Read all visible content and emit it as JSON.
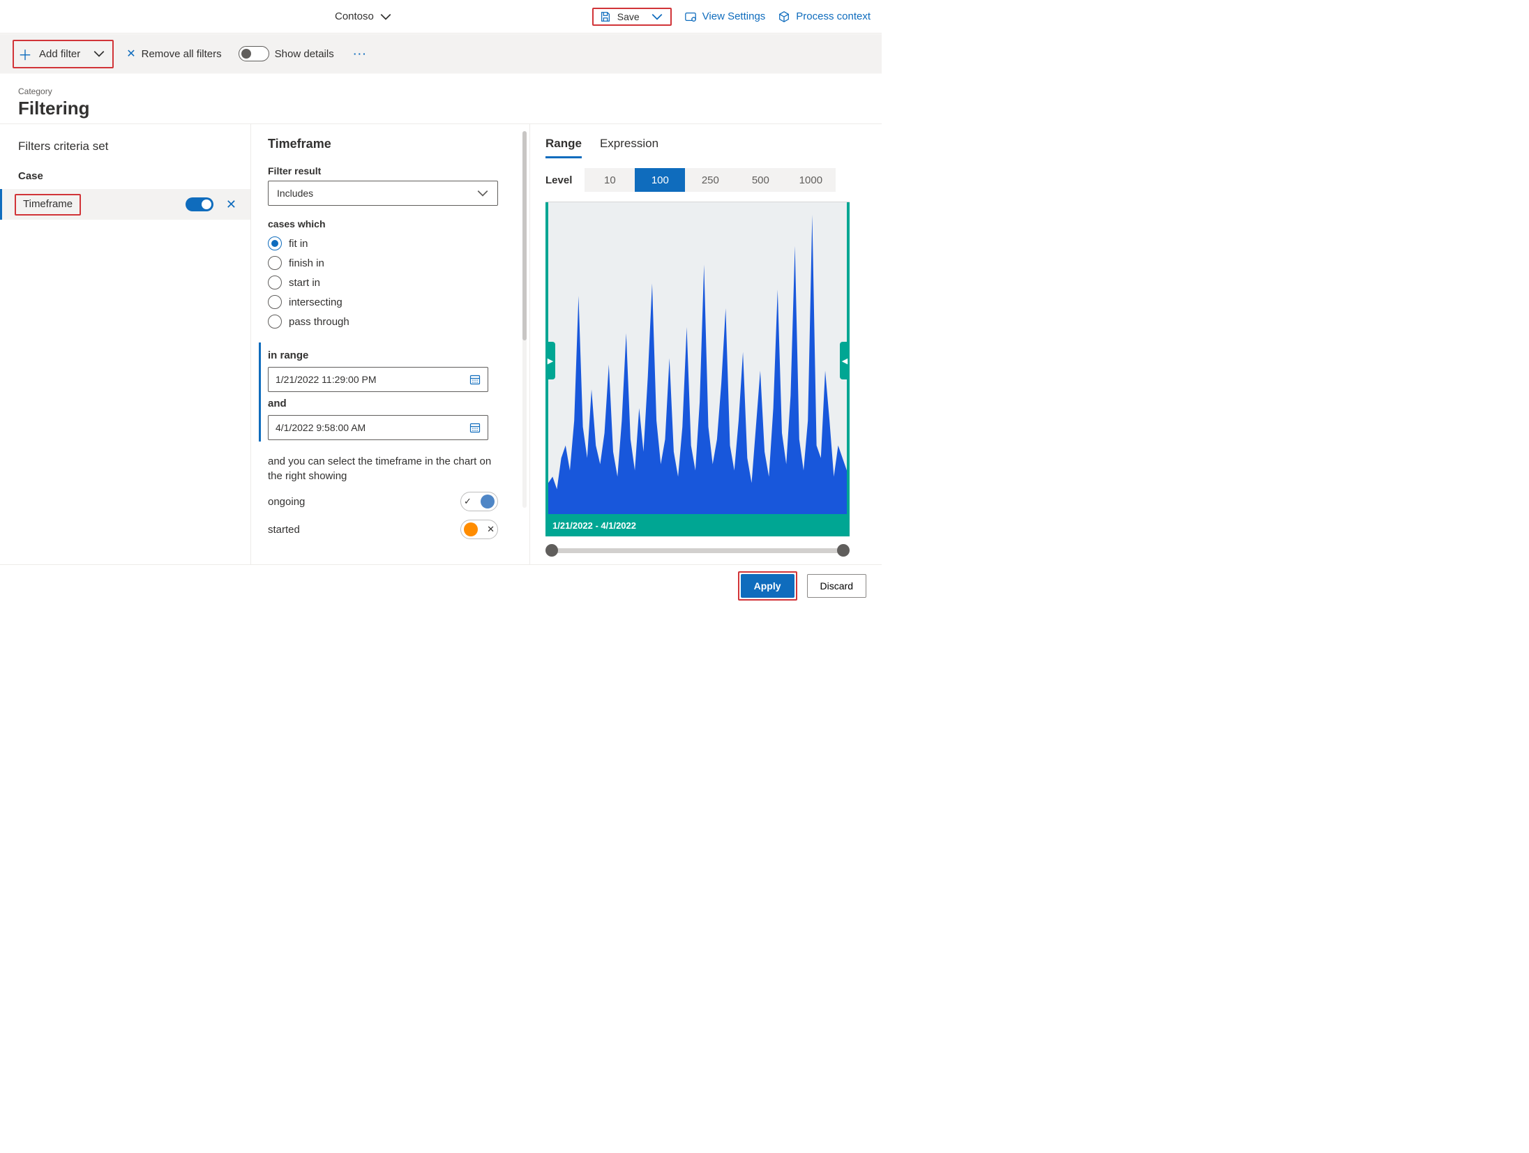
{
  "header": {
    "environment": "Contoso",
    "save_label": "Save",
    "view_settings_label": "View Settings",
    "process_context_label": "Process context"
  },
  "toolbar": {
    "add_filter_label": "Add filter",
    "remove_all_label": "Remove all filters",
    "show_details_label": "Show details"
  },
  "page": {
    "category_label": "Category",
    "title": "Filtering"
  },
  "left": {
    "heading": "Filters criteria set",
    "group_label": "Case",
    "item_label": "Timeframe"
  },
  "mid": {
    "title": "Timeframe",
    "filter_result_label": "Filter result",
    "filter_result_value": "Includes",
    "cases_which_label": "cases which",
    "radios": [
      "fit in",
      "finish in",
      "start in",
      "intersecting",
      "pass through"
    ],
    "in_range_label": "in range",
    "start_value": "1/21/2022 11:29:00 PM",
    "and_label": "and",
    "end_value": "4/1/2022 9:58:00 AM",
    "note_text": "and you can select the timeframe in the chart on the right showing",
    "ongoing_label": "ongoing",
    "started_label": "started"
  },
  "right": {
    "tabs": {
      "range": "Range",
      "expression": "Expression"
    },
    "level_label": "Level",
    "levels": [
      "10",
      "100",
      "250",
      "500",
      "1000"
    ],
    "active_level": "100",
    "chart_range_label": "1/21/2022 - 4/1/2022"
  },
  "footer": {
    "apply_label": "Apply",
    "discard_label": "Discard"
  },
  "chart_data": {
    "type": "area",
    "title": "",
    "xlabel": "",
    "ylabel": "",
    "ylim": [
      0,
      100
    ],
    "x_start": "1/21/2022",
    "x_end": "4/1/2022",
    "x": [
      1,
      2,
      3,
      4,
      5,
      6,
      7,
      8,
      9,
      10,
      11,
      12,
      13,
      14,
      15,
      16,
      17,
      18,
      19,
      20,
      21,
      22,
      23,
      24,
      25,
      26,
      27,
      28,
      29,
      30,
      31,
      32,
      33,
      34,
      35,
      36,
      37,
      38,
      39,
      40,
      41,
      42,
      43,
      44,
      45,
      46,
      47,
      48,
      49,
      50,
      51,
      52,
      53,
      54,
      55,
      56,
      57,
      58,
      59,
      60,
      61,
      62,
      63,
      64,
      65,
      66,
      67,
      68,
      69,
      70
    ],
    "values": [
      10,
      12,
      8,
      18,
      22,
      14,
      30,
      70,
      28,
      18,
      40,
      22,
      16,
      26,
      48,
      20,
      12,
      30,
      58,
      24,
      14,
      34,
      20,
      44,
      74,
      30,
      16,
      24,
      50,
      20,
      12,
      28,
      60,
      22,
      14,
      36,
      80,
      28,
      16,
      24,
      42,
      66,
      22,
      14,
      30,
      52,
      18,
      10,
      28,
      46,
      20,
      12,
      34,
      72,
      26,
      16,
      38,
      86,
      24,
      14,
      30,
      96,
      22,
      18,
      46,
      30,
      12,
      22,
      18,
      14
    ]
  }
}
